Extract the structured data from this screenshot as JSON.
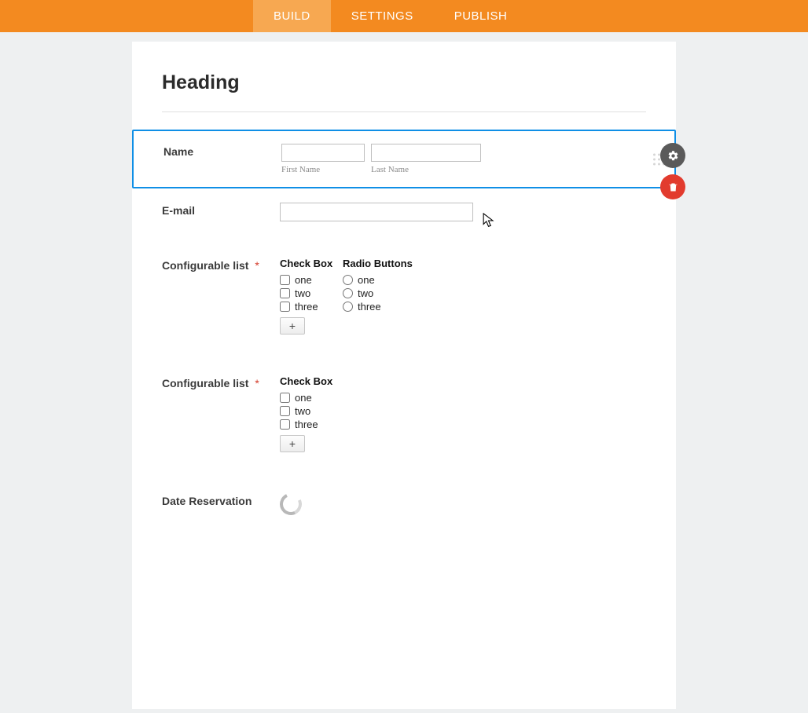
{
  "nav": {
    "tabs": [
      {
        "label": "BUILD",
        "active": true
      },
      {
        "label": "SETTINGS",
        "active": false
      },
      {
        "label": "PUBLISH",
        "active": false
      }
    ]
  },
  "form": {
    "heading": "Heading",
    "fields": {
      "name": {
        "label": "Name",
        "first_sublabel": "First Name",
        "last_sublabel": "Last Name"
      },
      "email": {
        "label": "E-mail"
      },
      "configList1": {
        "label": "Configurable list",
        "required_mark": "*",
        "columns": [
          {
            "header": "Check Box",
            "type": "checkbox",
            "options": [
              "one",
              "two",
              "three"
            ]
          },
          {
            "header": "Radio Buttons",
            "type": "radio",
            "options": [
              "one",
              "two",
              "three"
            ]
          }
        ],
        "add_label": "+"
      },
      "configList2": {
        "label": "Configurable list",
        "required_mark": "*",
        "columns": [
          {
            "header": "Check Box",
            "type": "checkbox",
            "options": [
              "one",
              "two",
              "three"
            ]
          }
        ],
        "add_label": "+"
      },
      "dateReservation": {
        "label": "Date Reservation"
      }
    }
  }
}
